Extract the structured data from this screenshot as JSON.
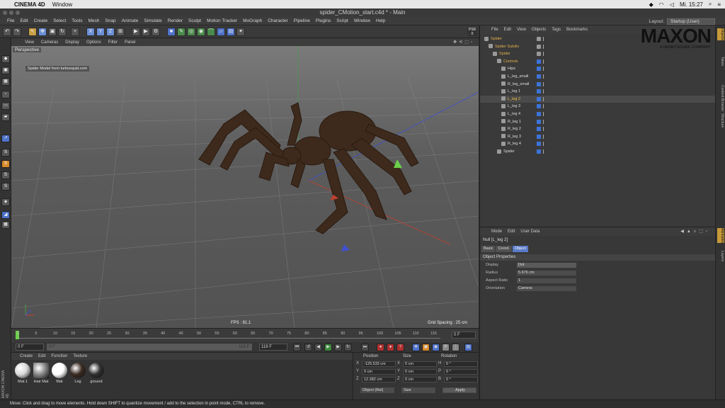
{
  "mac_menubar": {
    "app": "CINEMA 4D",
    "items": [
      "Window"
    ],
    "clock": "Mi. 15:27"
  },
  "window": {
    "title": "spider_CMotion_start.c4d * - Main"
  },
  "menubar": {
    "items": [
      "File",
      "Edit",
      "Create",
      "Select",
      "Tools",
      "Mesh",
      "Snap",
      "Animate",
      "Simulate",
      "Render",
      "Sculpt",
      "Motion Tracker",
      "MoGraph",
      "Character",
      "Pipeline",
      "Plugins",
      "Script",
      "Window",
      "Help"
    ],
    "layout_label": "Layout:",
    "layout_value": "Startup (User)"
  },
  "viewport": {
    "menu": [
      "View",
      "Cameras",
      "Display",
      "Options",
      "Filter",
      "Panel"
    ],
    "camera": "Perspective",
    "note": "Spider Model from turbosquid.com",
    "fps": "FPS : 81.1",
    "grid": "Grid Spacing : 25 cm"
  },
  "timeline": {
    "ticks": [
      "0",
      "5",
      "10",
      "15",
      "20",
      "25",
      "30",
      "35",
      "40",
      "45",
      "50",
      "55",
      "60",
      "65",
      "70",
      "75",
      "80",
      "85",
      "90",
      "95",
      "100",
      "105",
      "110",
      "115"
    ],
    "current": "0 F"
  },
  "transport": {
    "start": "0 F",
    "min": "0 F",
    "max": "118 F",
    "end": "118 F"
  },
  "materials": {
    "menu": [
      "Create",
      "Edit",
      "Function",
      "Texture"
    ],
    "items": [
      {
        "label": "Mat.1",
        "color": "#d8d8d8"
      },
      {
        "label": "Hair Mat",
        "color": "#8a8a8a"
      },
      {
        "label": "Mat",
        "color": "#ffffff"
      },
      {
        "label": "Leg",
        "color": "#3a2a22"
      },
      {
        "label": "ground",
        "color": "#2e2e2e"
      }
    ],
    "side_label": "MAXON CINEMA 4D"
  },
  "coords": {
    "headers": [
      "Position",
      "Size",
      "Rotation"
    ],
    "rows": [
      {
        "axis": "X",
        "pos": "-125.533 cm",
        "saxis": "X",
        "size": "0 cm",
        "raxis": "H",
        "rot": "0 °"
      },
      {
        "axis": "Y",
        "pos": "0 cm",
        "saxis": "Y",
        "size": "0 cm",
        "raxis": "P",
        "rot": "0 °"
      },
      {
        "axis": "Z",
        "pos": "12.382 cm",
        "saxis": "Z",
        "size": "0 cm",
        "raxis": "B",
        "rot": "0 °"
      }
    ],
    "mode": "Object (Rel)",
    "size_mode": "Size",
    "apply": "Apply"
  },
  "status": "Move: Click and drag to move elements. Hold down SHIFT to quantize movement / add to the selection in point mode, CTRL to remove.",
  "objects": {
    "menu": [
      "File",
      "Edit",
      "View",
      "Objects",
      "Tags",
      "Bookmarks"
    ],
    "rows": [
      {
        "name": "Spider",
        "indent": 0,
        "color": "#e0b04a"
      },
      {
        "name": "Spider Subdiv",
        "indent": 1,
        "color": "#e0b04a"
      },
      {
        "name": "Spider",
        "indent": 2,
        "color": "#e0b04a"
      },
      {
        "name": "Controls",
        "indent": 3,
        "color": "#e0b04a"
      },
      {
        "name": "Hips",
        "indent": 4,
        "color": "#dddddd"
      },
      {
        "name": "L_leg_small",
        "indent": 4,
        "color": "#dddddd"
      },
      {
        "name": "R_leg_small",
        "indent": 4,
        "color": "#dddddd"
      },
      {
        "name": "L_leg 1",
        "indent": 4,
        "color": "#dddddd"
      },
      {
        "name": "L_leg 2",
        "indent": 4,
        "color": "#f0c040"
      },
      {
        "name": "L_leg 3",
        "indent": 4,
        "color": "#dddddd"
      },
      {
        "name": "L_leg 4",
        "indent": 4,
        "color": "#dddddd"
      },
      {
        "name": "R_leg 1",
        "indent": 4,
        "color": "#dddddd"
      },
      {
        "name": "R_leg 2",
        "indent": 4,
        "color": "#dddddd"
      },
      {
        "name": "R_leg 3",
        "indent": 4,
        "color": "#dddddd"
      },
      {
        "name": "R_leg 4",
        "indent": 4,
        "color": "#dddddd"
      },
      {
        "name": "Spider",
        "indent": 3,
        "color": "#dddddd"
      }
    ]
  },
  "brand": {
    "logo": "MAXON",
    "sub": "A NEMETSCHEK COMPANY"
  },
  "attributes": {
    "menu": [
      "Mode",
      "Edit",
      "User Data"
    ],
    "title": "Null [L_leg 2]",
    "tabs": [
      "Basic",
      "Coord.",
      "Object"
    ],
    "section": "Object Properties",
    "props": [
      {
        "label": "Display",
        "value": "Dot"
      },
      {
        "label": "Radius",
        "value": "5.676 cm"
      },
      {
        "label": "Aspect Ratio",
        "value": "1"
      },
      {
        "label": "Orientation",
        "value": "Camera"
      }
    ]
  },
  "side_tabs": [
    "Objects",
    "Takes",
    "Content Browser",
    "Structure"
  ],
  "side_tabs_lower": [
    "Attributes",
    "Layers"
  ]
}
